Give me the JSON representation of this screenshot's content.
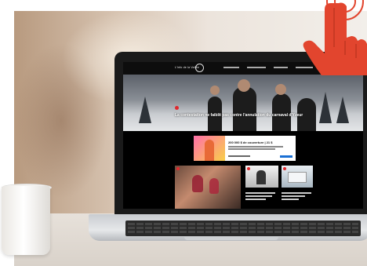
{
  "website": {
    "brand": "L'info de la Vallée",
    "hero": {
      "headline": "La contestation ne faiblit pas contre l'annulation du carnaval d'Yzeur"
    },
    "promo": {
      "title": "200 000 $ de couverture | 21 $"
    }
  },
  "colors": {
    "accent_red": "#e0282d",
    "hand_red": "#e2452e",
    "promo_button": "#1a6fd4"
  }
}
